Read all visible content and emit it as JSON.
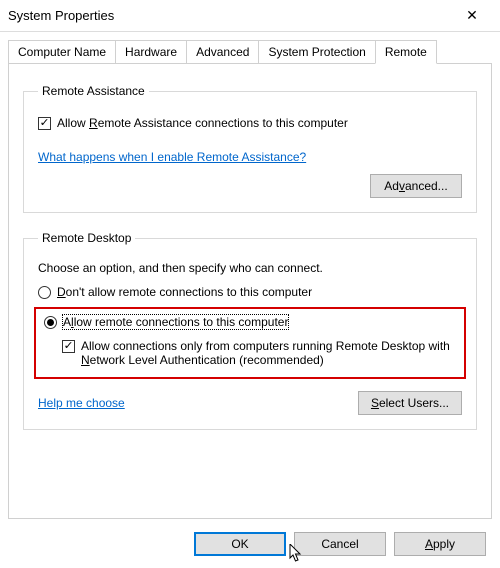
{
  "window": {
    "title": "System Properties",
    "close": "✕"
  },
  "tabs": {
    "computer_name": "Computer Name",
    "hardware": "Hardware",
    "advanced": "Advanced",
    "system_protection": "System Protection",
    "remote": "Remote"
  },
  "remote_assistance": {
    "legend": "Remote Assistance",
    "allow_label_pre": "Allow ",
    "allow_label_u": "R",
    "allow_label_post": "emote Assistance connections to this computer",
    "help_link": "What happens when I enable Remote Assistance?",
    "advanced_btn_pre": "Ad",
    "advanced_btn_u": "v",
    "advanced_btn_post": "anced..."
  },
  "remote_desktop": {
    "legend": "Remote Desktop",
    "desc": "Choose an option, and then specify who can connect.",
    "dont_allow_u": "D",
    "dont_allow_post": "on't allow remote connections to this computer",
    "allow_pre": "A",
    "allow_u": "l",
    "allow_post": "low remote connections to this computer",
    "nla_pre": "Allow connections only from computers running Remote Desktop with ",
    "nla_u": "N",
    "nla_post": "etwork Level Authentication (recommended)",
    "help_link": "Help me choose",
    "select_users_u": "S",
    "select_users_post": "elect Users..."
  },
  "buttons": {
    "ok": "OK",
    "cancel": "Cancel",
    "apply_u": "A",
    "apply_post": "pply"
  }
}
